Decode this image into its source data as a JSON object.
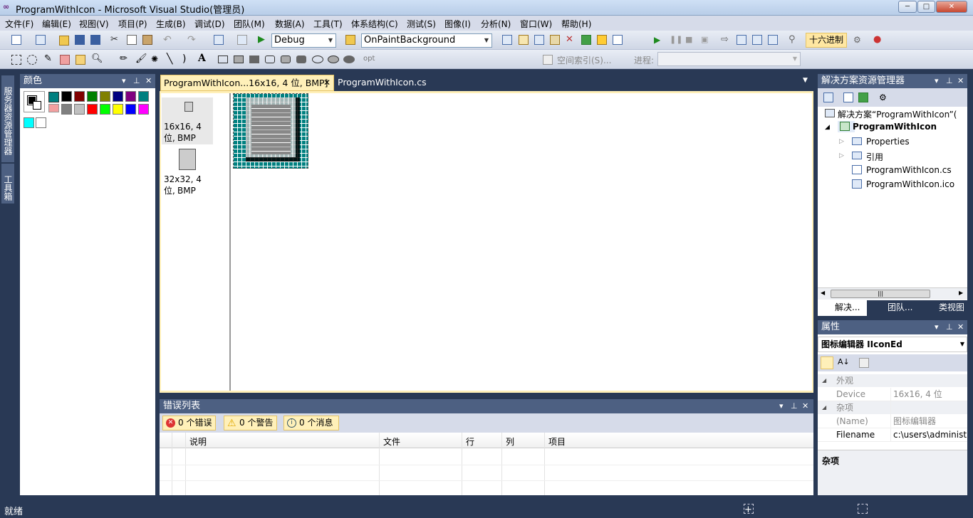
{
  "window": {
    "title": "ProgramWithIcon - Microsoft Visual Studio(管理员)",
    "controls": [
      "─",
      "□",
      "✕"
    ]
  },
  "menu": [
    "文件(F)",
    "编辑(E)",
    "视图(V)",
    "项目(P)",
    "生成(B)",
    "调试(D)",
    "团队(M)",
    "数据(A)",
    "工具(T)",
    "体系结构(C)",
    "测试(S)",
    "图像(I)",
    "分析(N)",
    "窗口(W)",
    "帮助(H)"
  ],
  "toolbar": {
    "config": "Debug",
    "target": "OnPaintBackground",
    "hex_label": "十六进制",
    "opt": "opt",
    "space_index": "空间索引(S)...",
    "progress_label": "进程:"
  },
  "side_tabs": [
    "服务器资源管理器",
    "工具箱"
  ],
  "colors_panel": {
    "title": "颜色",
    "swatches": [
      "#008080",
      "#000000",
      "#800000",
      "#008000",
      "#808000",
      "#000080",
      "#800080",
      "#008080",
      "#808080",
      "#c0c0c0",
      "#ff0000",
      "#00ff00",
      "#ffff00",
      "#0000ff",
      "#ff00ff",
      "#00ffff",
      "#ffffff"
    ]
  },
  "editor": {
    "tabs": [
      {
        "label": "ProgramWithIcon...16x16, 4 位, BMP]",
        "active": true
      },
      {
        "label": "ProgramWithIcon.cs",
        "active": false
      }
    ],
    "images": [
      {
        "label": "16x16, 4 位,\nBMP",
        "line1": "16x16, 4 位,",
        "line2": "BMP"
      },
      {
        "line1": "32x32, 4 位,",
        "line2": "BMP"
      }
    ]
  },
  "error_list": {
    "title": "错误列表",
    "filters": [
      "0 个错误",
      "0 个警告",
      "0 个消息"
    ],
    "columns": [
      "说明",
      "文件",
      "行",
      "列",
      "项目"
    ]
  },
  "solution_explorer": {
    "title": "解决方案资源管理器",
    "solution": "解决方案“ProgramWithIcon”(",
    "project": "ProgramWithIcon",
    "items": [
      "Properties",
      "引用",
      "ProgramWithIcon.cs",
      "ProgramWithIcon.ico"
    ],
    "bottom_tabs": [
      "解决...",
      "团队...",
      "类视图"
    ]
  },
  "properties": {
    "title": "属性",
    "object": "图标编辑器  IIconEd",
    "sections": [
      {
        "name": "外观",
        "rows": [
          {
            "k": "Device",
            "v": "16x16, 4 位"
          }
        ]
      },
      {
        "name": "杂项",
        "rows": [
          {
            "k": "(Name)",
            "v": "图标编辑器"
          },
          {
            "k": "Filename",
            "v": "c:\\users\\administr"
          }
        ]
      }
    ],
    "desc_title": "杂项"
  },
  "status": {
    "text": "就绪"
  }
}
